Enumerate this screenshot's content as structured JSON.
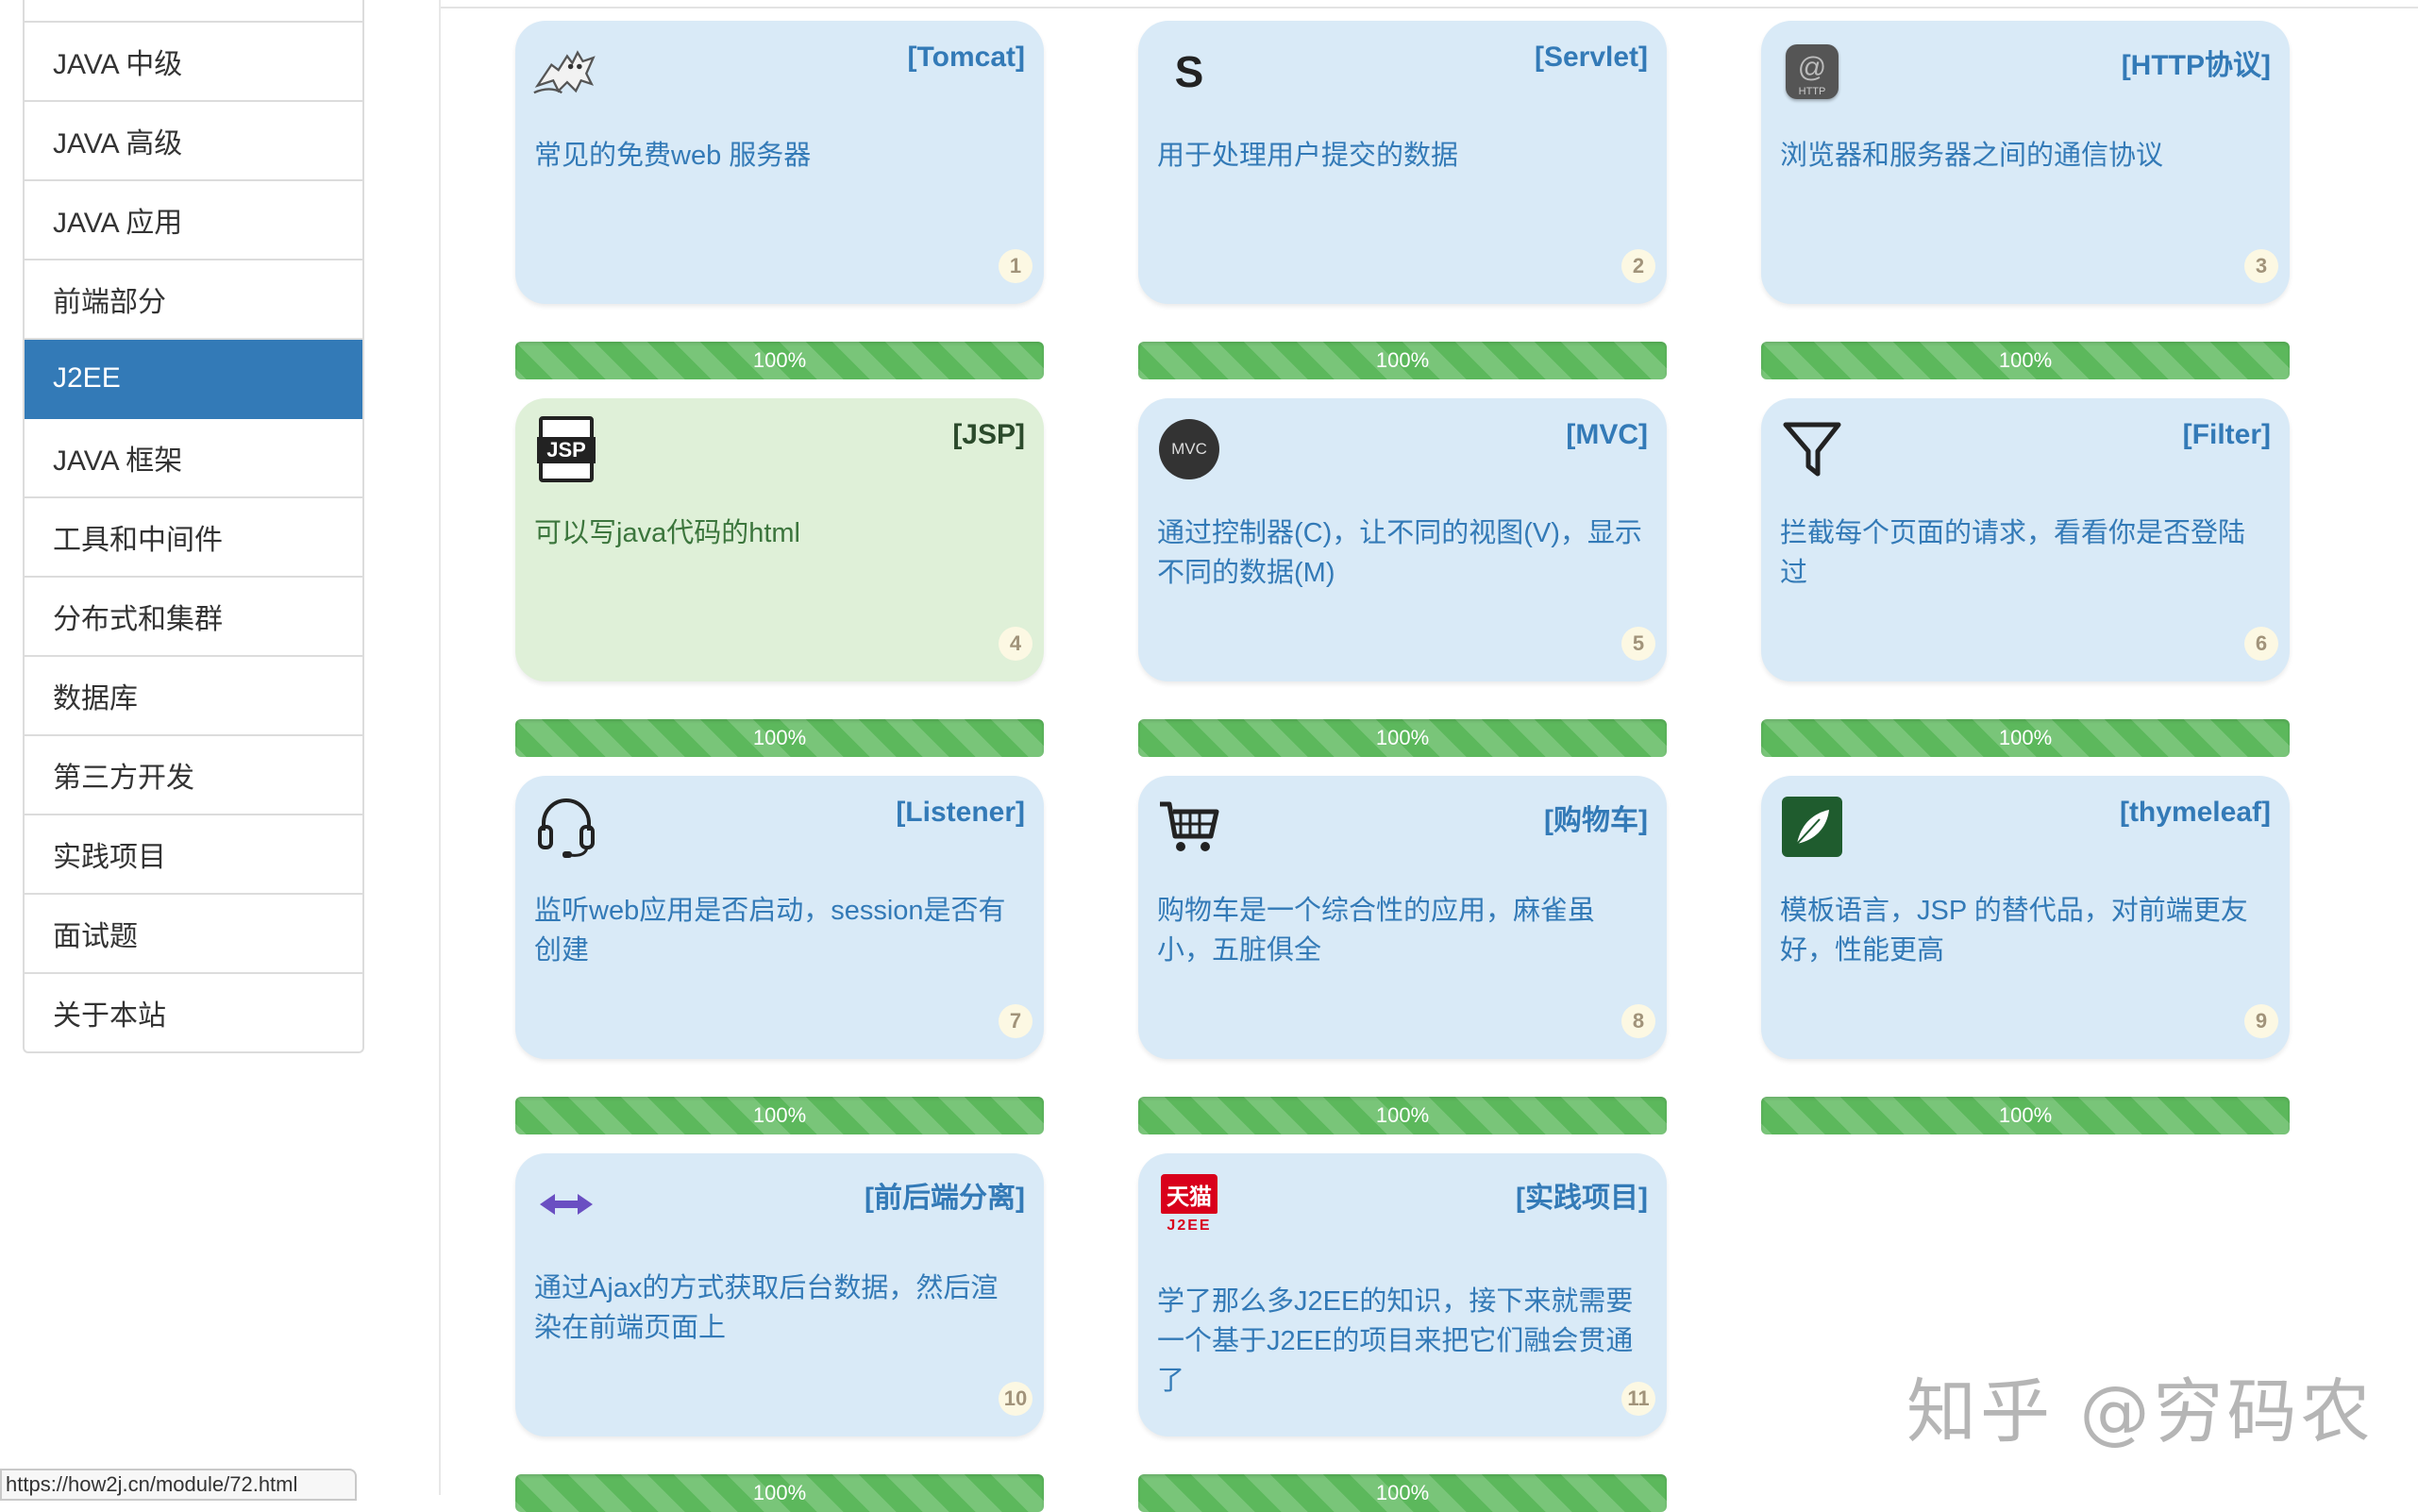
{
  "sidebar": {
    "items": [
      {
        "label": "JAVA 中级",
        "active": false
      },
      {
        "label": "JAVA 高级",
        "active": false
      },
      {
        "label": "JAVA 应用",
        "active": false
      },
      {
        "label": "前端部分",
        "active": false
      },
      {
        "label": "J2EE",
        "active": true
      },
      {
        "label": "JAVA 框架",
        "active": false
      },
      {
        "label": "工具和中间件",
        "active": false
      },
      {
        "label": "分布式和集群",
        "active": false
      },
      {
        "label": "数据库",
        "active": false
      },
      {
        "label": "第三方开发",
        "active": false
      },
      {
        "label": "实践项目",
        "active": false
      },
      {
        "label": "面试题",
        "active": false
      },
      {
        "label": "关于本站",
        "active": false
      }
    ],
    "active_color": "#337ab7"
  },
  "cards": [
    {
      "icon": "tomcat-icon",
      "title": "[Tomcat]",
      "desc": "常见的免费web 服务器",
      "num": "1",
      "progress_label": "100%",
      "progress": 1.0
    },
    {
      "icon": "servlet-icon",
      "icon_text": "S",
      "title": "[Servlet]",
      "desc": "用于处理用户提交的数据",
      "num": "2",
      "progress_label": "100%",
      "progress": 1.0
    },
    {
      "icon": "http-icon",
      "icon_text": "HTTP",
      "title": "[HTTP协议]",
      "desc": "浏览器和服务器之间的通信协议",
      "num": "3",
      "progress_label": "100%",
      "progress": 1.0
    },
    {
      "icon": "jsp-icon",
      "icon_text": "JSP",
      "title": "[JSP]",
      "desc": "可以写java代码的html",
      "num": "4",
      "progress_label": "100%",
      "progress": 1.0,
      "highlight": true
    },
    {
      "icon": "mvc-icon",
      "icon_text": "MVC",
      "title": "[MVC]",
      "desc": "通过控制器(C)，让不同的视图(V)，显示不同的数据(M)",
      "num": "5",
      "progress_label": "100%",
      "progress": 1.0
    },
    {
      "icon": "filter-icon",
      "title": "[Filter]",
      "desc": "拦截每个页面的请求，看看你是否登陆过",
      "num": "6",
      "progress_label": "100%",
      "progress": 1.0
    },
    {
      "icon": "headset-icon",
      "title": "[Listener]",
      "desc": "监听web应用是否启动，session是否有创建",
      "num": "7",
      "progress_label": "100%",
      "progress": 1.0
    },
    {
      "icon": "cart-icon",
      "title": "[购物车]",
      "desc": "购物车是一个综合性的应用，麻雀虽小，五脏俱全",
      "num": "8",
      "progress_label": "100%",
      "progress": 1.0
    },
    {
      "icon": "leaf-icon",
      "title": "[thymeleaf]",
      "desc": "模板语言，JSP 的替代品，对前端更友好，性能更高",
      "num": "9",
      "progress_label": "100%",
      "progress": 1.0
    },
    {
      "icon": "arrows-icon",
      "title": "[前后端分离]",
      "desc": "通过Ajax的方式获取后台数据，然后渲染在前端页面上",
      "num": "10",
      "progress_label": "100%",
      "progress": 1.0
    },
    {
      "icon": "tmall-icon",
      "icon_text": "天猫",
      "icon_sub": "J2EE",
      "title": "[实践项目]",
      "desc": "学了那么多J2EE的知识，接下来就需要一个基于J2EE的项目来把它们融会贯通了",
      "num": "11",
      "progress_label": "100%",
      "progress": 1.0
    }
  ],
  "status_url": "https://how2j.cn/module/72.html",
  "watermark": "知乎 @穷码农",
  "colors": {
    "card_bg": "#d9eaf7",
    "card_highlight_bg": "#dff0d8",
    "progress_green": "#5cb85c",
    "link_blue": "#337ab7"
  }
}
